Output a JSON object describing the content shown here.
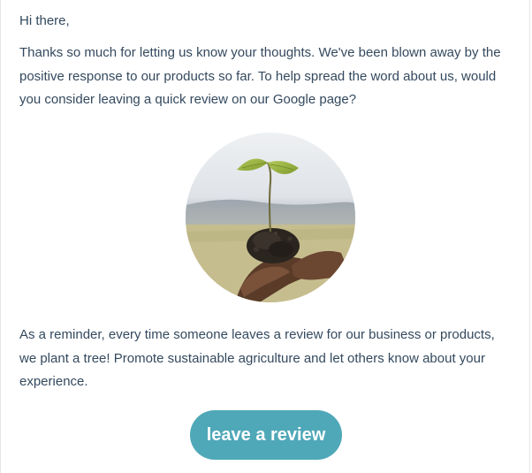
{
  "email": {
    "greeting": "Hi there,",
    "paragraph_1": "Thanks so much for letting us know your thoughts. We've been blown away by the positive response to our products so far. To help spread the word about us, would you consider leaving a quick review on our Google page?",
    "hero_image": "seedling-in-soil-held-by-hands",
    "paragraph_2": "As a reminder, every time someone leaves a review for our business or products, we plant a tree! Promote sustainable agriculture and let others know about your experience.",
    "cta_label": "leave a review"
  },
  "colors": {
    "text": "#34495e",
    "button": "#4fa8b8",
    "button_text": "#ffffff"
  }
}
